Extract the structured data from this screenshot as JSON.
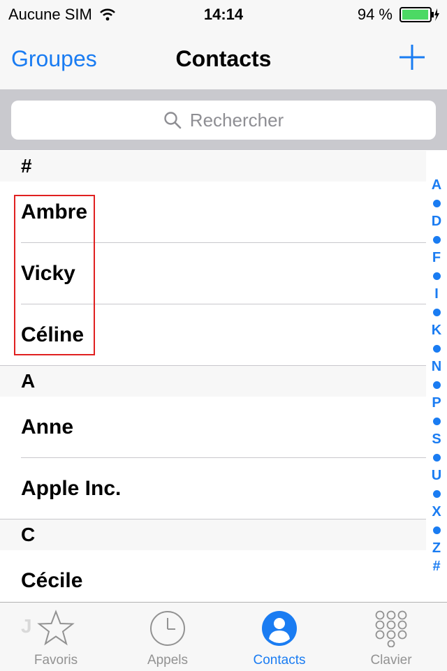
{
  "status": {
    "carrier": "Aucune SIM",
    "time": "14:14",
    "battery": "94 %"
  },
  "nav": {
    "left": "Groupes",
    "title": "Contacts"
  },
  "search": {
    "placeholder": "Rechercher"
  },
  "sections": [
    {
      "header": "#",
      "rows": [
        "Ambre",
        "Vicky",
        "Céline"
      ]
    },
    {
      "header": "A",
      "rows": [
        "Anne",
        "Apple Inc."
      ]
    },
    {
      "header": "C",
      "rows": [
        "Cécile"
      ]
    }
  ],
  "index": [
    "A",
    "D",
    "F",
    "I",
    "K",
    "N",
    "P",
    "S",
    "U",
    "X",
    "Z",
    "#"
  ],
  "peek_letter": "J",
  "tabs": [
    {
      "label": "Favoris",
      "icon": "star-icon"
    },
    {
      "label": "Appels",
      "icon": "clock-icon"
    },
    {
      "label": "Contacts",
      "icon": "contacts-icon"
    },
    {
      "label": "Clavier",
      "icon": "keypad-icon"
    }
  ],
  "active_tab": "Contacts",
  "colors": {
    "accent": "#1a7cf2",
    "highlight": "#e02020",
    "battery": "#4cd964"
  }
}
